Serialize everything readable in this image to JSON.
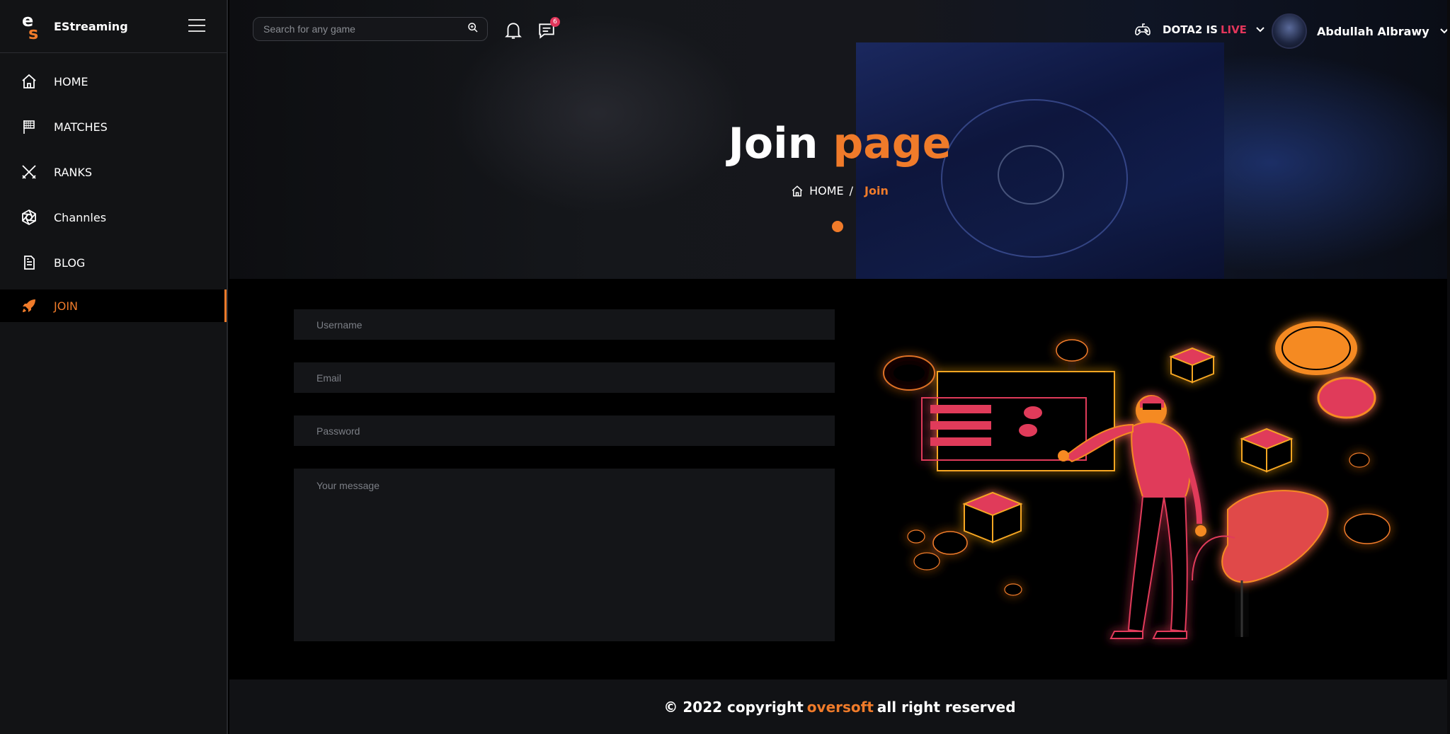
{
  "brand": {
    "name": "EStreaming",
    "logo_letter_top": "e",
    "logo_letter_bottom": "s"
  },
  "nav": {
    "items": [
      {
        "label": "HOME",
        "icon": "home-icon"
      },
      {
        "label": "MATCHES",
        "icon": "flag-icon"
      },
      {
        "label": "RANKS",
        "icon": "crossed-swords-icon"
      },
      {
        "label": "Channles",
        "icon": "aperture-icon"
      },
      {
        "label": "BLOG",
        "icon": "document-icon"
      },
      {
        "label": "JOIN",
        "icon": "rocket-icon",
        "active": true
      }
    ]
  },
  "topbar": {
    "search_placeholder": "Search for any game",
    "messages_badge": "6",
    "live_prefix": "DOTA2 IS",
    "live_word": "LIVE",
    "user_name": "Abdullah Albrawy"
  },
  "hero": {
    "title_main": "Join",
    "title_accent": "page",
    "breadcrumb_home": "HOME",
    "breadcrumb_sep": "/",
    "breadcrumb_current": "Join"
  },
  "form": {
    "username_placeholder": "Username",
    "email_placeholder": "Email",
    "password_placeholder": "Password",
    "message_placeholder": "Your message"
  },
  "footer": {
    "prefix": "© 2022 copyright",
    "brand": "oversoft",
    "suffix": "all right reserved"
  },
  "colors": {
    "accent": "#f07b2a",
    "live": "#e2365b",
    "sidebar_bg": "#121315",
    "field_bg": "#141518"
  }
}
